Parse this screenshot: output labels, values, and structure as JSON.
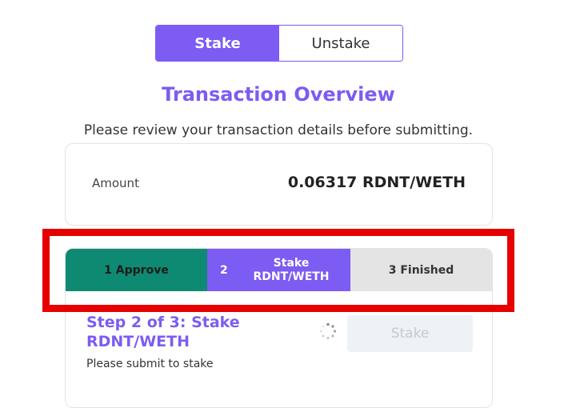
{
  "tabs": {
    "stake": "Stake",
    "unstake": "Unstake"
  },
  "overview": {
    "title": "Transaction Overview",
    "subtitle": "Please review your transaction details before submitting.",
    "amount_label": "Amount",
    "amount_value": "0.06317 RDNT/WETH"
  },
  "steps": [
    {
      "label": "1 Approve",
      "state": "done"
    },
    {
      "number": "2",
      "label": "Stake RDNT/WETH",
      "state": "active"
    },
    {
      "label": "3 Finished",
      "state": "pending"
    }
  ],
  "current_step": {
    "title": "Step 2 of 3: Stake RDNT/WETH",
    "description": "Please submit to stake",
    "button_label": "Stake"
  },
  "colors": {
    "accent": "#7c5cf2",
    "step_done": "#0e8a72",
    "step_pending": "#e4e4e4",
    "highlight": "#e60000"
  },
  "icons": {
    "spinner": "loading-spinner-icon"
  }
}
